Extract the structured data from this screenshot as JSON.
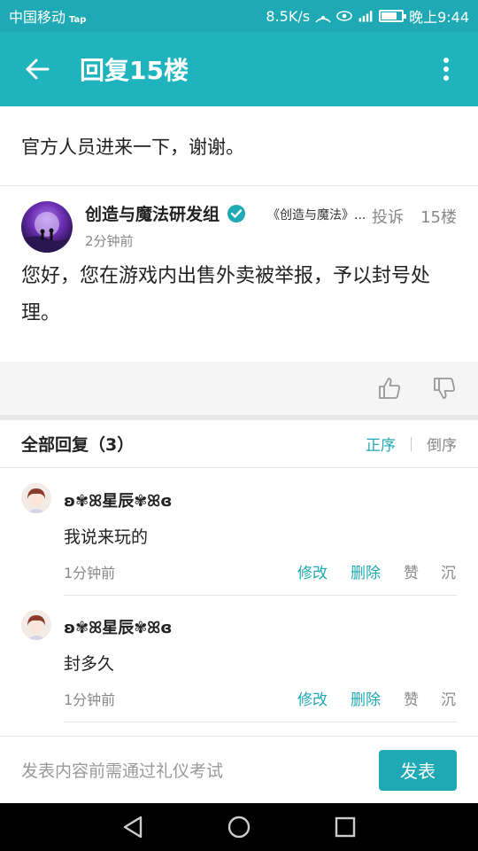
{
  "status_bar": {
    "carrier": "中国移动",
    "tap_label": "Tap",
    "speed": "8.5K/s",
    "time": "晚上9:44",
    "battery_level": 0.8
  },
  "app_bar": {
    "title": "回复15楼"
  },
  "thread": {
    "title": "官方人员进来一下，谢谢。"
  },
  "post": {
    "author": "创造与魔法研发组",
    "group": "《创造与魔法》...",
    "report_label": "投诉",
    "floor": "15楼",
    "time": "2分钟前",
    "body": "您好，您在游戏内出售外卖被举报，予以封号处理。"
  },
  "replies_header": {
    "title": "全部回复（3）",
    "sort_asc": "正序",
    "sort_desc": "倒序"
  },
  "replies": [
    {
      "name": "ʚ✾ꕤ星辰✾ꕤɞ",
      "text": "我说来玩的",
      "time": "1分钟前",
      "edit": "修改",
      "delete": "删除",
      "like": "赞",
      "sink": "沉"
    },
    {
      "name": "ʚ✾ꕤ星辰✾ꕤɞ",
      "text": "封多久",
      "time": "1分钟前",
      "edit": "修改",
      "delete": "删除",
      "like": "赞",
      "sink": "沉"
    }
  ],
  "input_bar": {
    "placeholder": "发表内容前需通过礼仪考试",
    "send_label": "发表"
  },
  "colors": {
    "accent": "#1fa9b4",
    "status_bar": "#1fa9b4",
    "app_bar": "#1fb3be"
  }
}
